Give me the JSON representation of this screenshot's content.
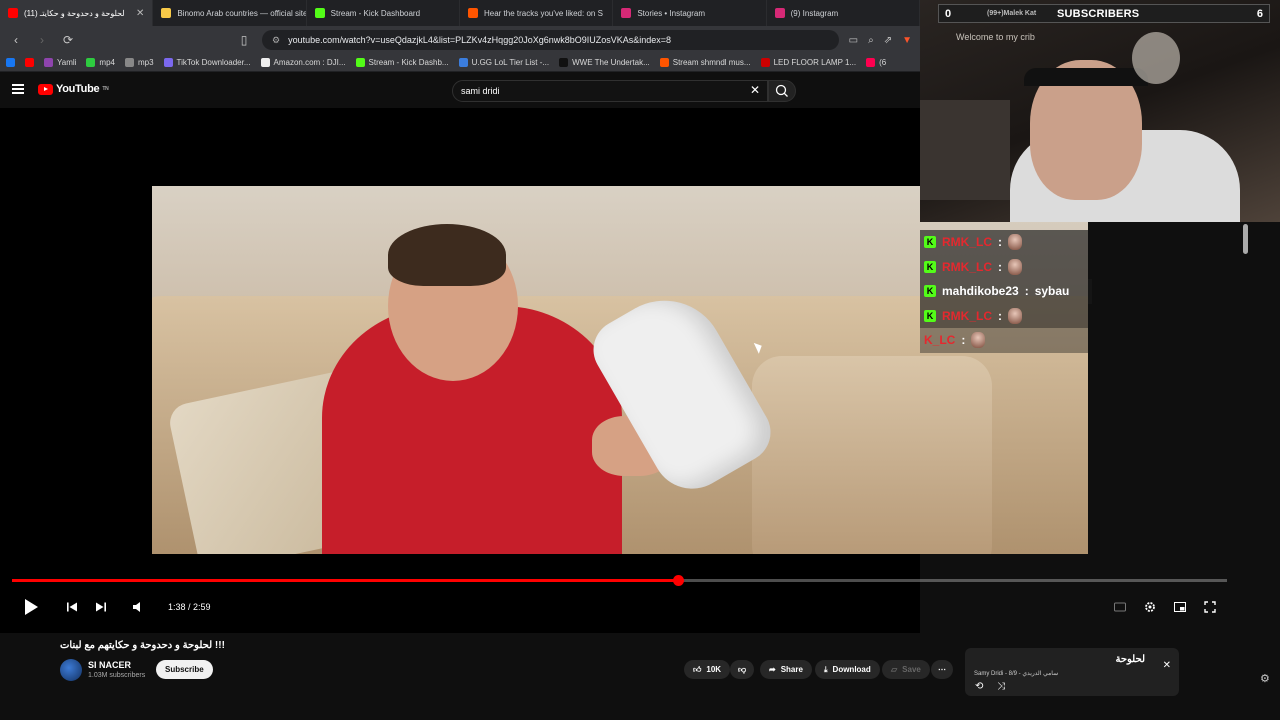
{
  "browser": {
    "tabs": [
      {
        "label": "لحلوحة و دحدوحة و حكايتـ (11)",
        "color": "#ff0000",
        "active": true
      },
      {
        "label": "Binomo Arab countries — official site",
        "color": "#f7c948",
        "active": false
      },
      {
        "label": "Stream - Kick Dashboard",
        "color": "#53fc18",
        "active": false
      },
      {
        "label": "Hear the tracks you've liked: on S",
        "color": "#ff5500",
        "active": false
      },
      {
        "label": "Stories • Instagram",
        "color": "#d62976",
        "active": false
      },
      {
        "label": "(9) Instagram",
        "color": "#d62976",
        "active": false
      }
    ],
    "url": "youtube.com/watch?v=useQdazjkL4&list=PLZKv4zHqgg20JoXg6nwk8bO9IUZosVKAs&index=8",
    "bookmarks": [
      {
        "label": "",
        "color": "#1877f2"
      },
      {
        "label": "",
        "color": "#ff0000"
      },
      {
        "label": "Yamli",
        "color": "#8e44ad"
      },
      {
        "label": "mp4",
        "color": "#2ecc40"
      },
      {
        "label": "mp3",
        "color": "#888888"
      },
      {
        "label": "TikTok Downloader...",
        "color": "#7b68ee"
      },
      {
        "label": "Amazon.com : DJI...",
        "color": "#eeeeee"
      },
      {
        "label": "Stream - Kick Dashb...",
        "color": "#53fc18"
      },
      {
        "label": "U.GG LoL Tier List -...",
        "color": "#3b7ddd"
      },
      {
        "label": "WWE The Undertak...",
        "color": "#111111"
      },
      {
        "label": "Stream shmndl mus...",
        "color": "#ff5500"
      },
      {
        "label": "LED FLOOR LAMP 1...",
        "color": "#cc0000"
      },
      {
        "label": "(6",
        "color": "#ff0050"
      }
    ]
  },
  "youtube": {
    "logo": "YouTube",
    "logo_tm": "TN",
    "search_value": "sami dridi",
    "time_display": "1:38 / 2:59",
    "progress": 0.548,
    "title": "لحلوحة و دحدوحة و حكايتهم مع لبنات !!!",
    "channel": "SI NACER",
    "subscribers": "1.03M subscribers",
    "subscribe_label": "Subscribe",
    "like_count": "10K",
    "share_label": "Share",
    "download_label": "Download",
    "save_label": "Save"
  },
  "playlist": {
    "title": "لحلوحة",
    "subtitle": "Samy Dridi - سامي الدريدي - 8/9"
  },
  "overlay": {
    "subs_left": "0",
    "subs_user": "(99+)Malek Kat",
    "subs_label": "SUBSCRIBERS",
    "subs_right": "6",
    "cam_text": "Welcome to my crib"
  },
  "chat": [
    {
      "user": "RMK_LC",
      "sep": ":",
      "message": "",
      "red": true,
      "kick": true,
      "emote": true
    },
    {
      "user": "RMK_LC",
      "sep": ":",
      "message": "",
      "red": true,
      "kick": true,
      "emote": true
    },
    {
      "user": "mahdikobe23",
      "sep": ":",
      "message": "sybau",
      "red": false,
      "kick": true,
      "emote": false
    },
    {
      "user": "RMK_LC",
      "sep": ":",
      "message": "",
      "red": true,
      "kick": true,
      "emote": true
    },
    {
      "user": "K_LC",
      "sep": ":",
      "message": "",
      "red": true,
      "kick": false,
      "emote": true
    }
  ]
}
